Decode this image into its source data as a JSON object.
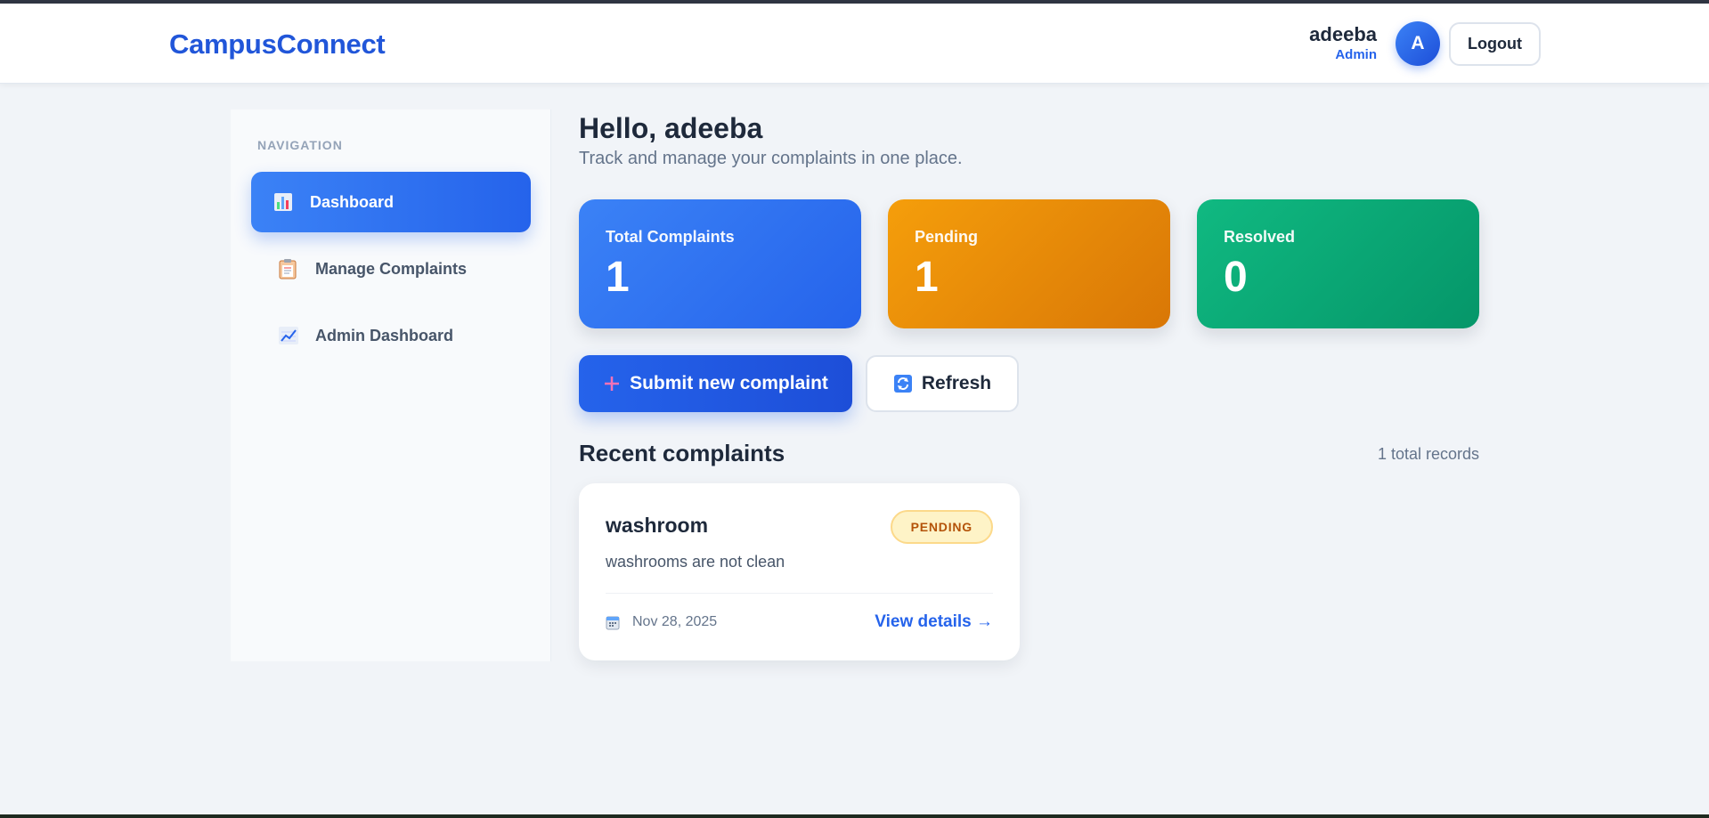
{
  "app": {
    "brand": "CampusConnect"
  },
  "header": {
    "user_name": "adeeba",
    "user_role": "Admin",
    "avatar_initial": "A",
    "logout_label": "Logout"
  },
  "sidebar": {
    "heading": "NAVIGATION",
    "items": [
      {
        "label": "Dashboard",
        "icon": "bar-chart-icon",
        "active": true
      },
      {
        "label": "Manage Complaints",
        "icon": "clipboard-icon",
        "active": false
      },
      {
        "label": "Admin Dashboard",
        "icon": "line-chart-icon",
        "active": false
      }
    ]
  },
  "main": {
    "greeting": "Hello, adeeba",
    "subtitle": "Track and manage your complaints in one place.",
    "stats": [
      {
        "label": "Total Complaints",
        "value": "1",
        "color": "#3b82f6"
      },
      {
        "label": "Pending",
        "value": "1",
        "color": "#f59e0b"
      },
      {
        "label": "Resolved",
        "value": "0",
        "color": "#10b981"
      }
    ],
    "actions": {
      "submit_label": "Submit new complaint",
      "refresh_label": "Refresh"
    },
    "recent": {
      "title": "Recent complaints",
      "count_text": "1 total records",
      "items": [
        {
          "title": "washroom",
          "status": "PENDING",
          "description": "washrooms are not clean",
          "date": "Nov 28, 2025",
          "link_label": "View details →"
        }
      ]
    }
  },
  "colors": {
    "accent": "#2563eb",
    "pending": "#f59e0b",
    "resolved": "#10b981"
  }
}
